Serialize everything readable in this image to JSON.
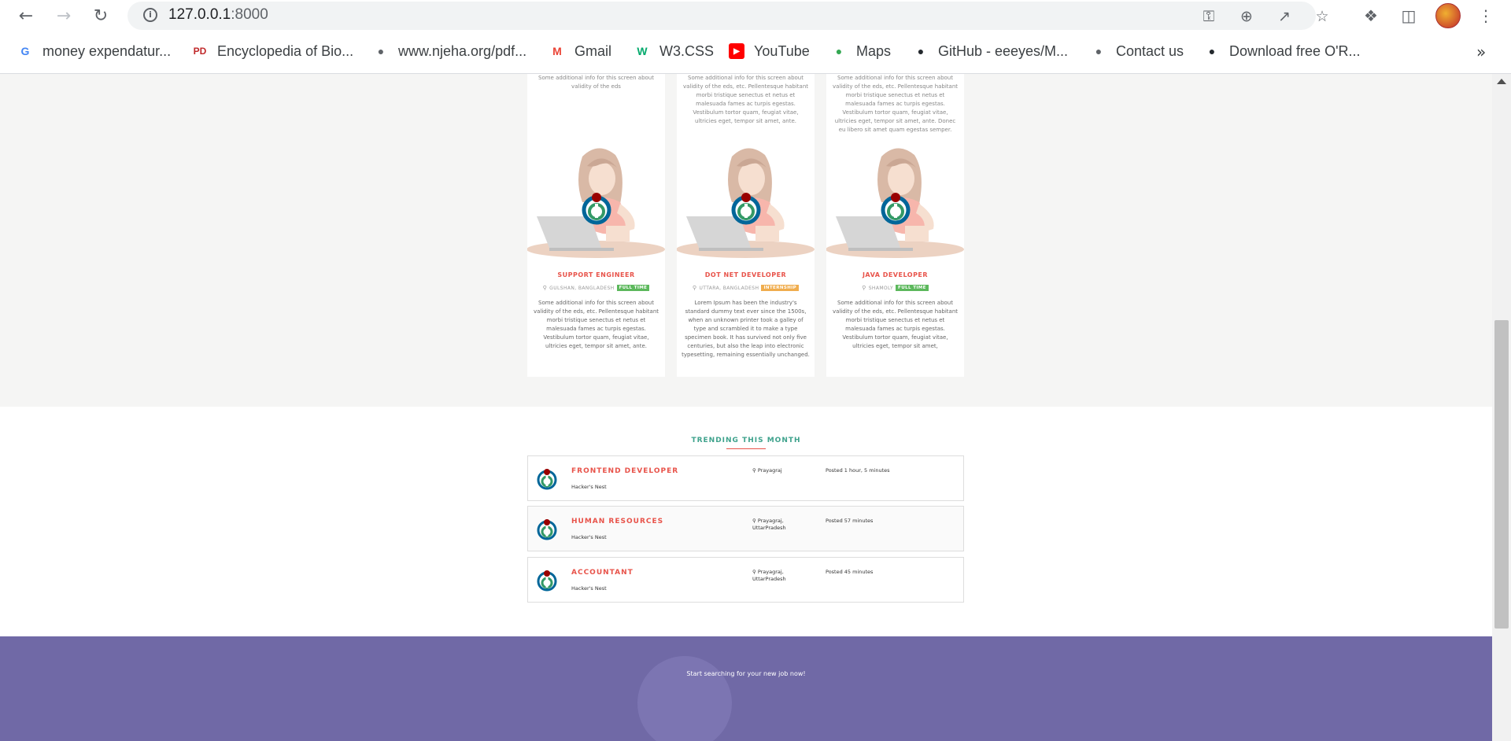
{
  "browser": {
    "url_host": "127.0.0.1",
    "url_port": ":8000",
    "bookmarks": [
      {
        "label": "money expendatur...",
        "icon": "google-icon",
        "color": "#4285f4"
      },
      {
        "label": "Encyclopedia of Bio...",
        "icon": "pd-icon",
        "color": "#c0282a"
      },
      {
        "label": "www.njeha.org/pdf...",
        "icon": "globe-icon",
        "color": "#5f6368"
      },
      {
        "label": "Gmail",
        "icon": "gmail-icon",
        "color": "#ea4335"
      },
      {
        "label": "W3.CSS",
        "icon": "w3-icon",
        "color": "#04aa6d"
      },
      {
        "label": "YouTube",
        "icon": "youtube-icon",
        "color": "#ff0000"
      },
      {
        "label": "Maps",
        "icon": "maps-icon",
        "color": "#34a853"
      },
      {
        "label": "GitHub - eeeyes/M...",
        "icon": "github-icon",
        "color": "#24292e"
      },
      {
        "label": "Contact us",
        "icon": "globe-icon",
        "color": "#5f6368"
      },
      {
        "label": "Download free O'R...",
        "icon": "github-icon",
        "color": "#24292e"
      }
    ],
    "more_label": "»"
  },
  "cards": [
    {
      "top_text": "Some additional info for this screen about validity of the eds",
      "title": "SUPPORT ENGINEER",
      "location": "GULSHAN, BANGLADESH",
      "badge": "FULL TIME",
      "badge_color": "#5cb85c",
      "description": "Some additional info for this screen about validity of the eds, etc. Pellentesque habitant morbi tristique senectus et netus et malesuada fames ac turpis egestas. Vestibulum tortor quam, feugiat vitae, ultricies eget, tempor sit amet, ante."
    },
    {
      "top_text": "Some additional info for this screen about validity of the eds, etc. Pellentesque habitant morbi tristique senectus et netus et malesuada fames ac turpis egestas. Vestibulum tortor quam, feugiat vitae, ultricies eget, tempor sit amet, ante.",
      "title": "DOT NET DEVELOPER",
      "location": "UTTARA, BANGLADESH",
      "badge": "INTERNSHIP",
      "badge_color": "#f0ad4e",
      "description": "Lorem Ipsum has been the industry's standard dummy text ever since the 1500s, when an unknown printer took a galley of type and scrambled it to make a type specimen book. It has survived not only five centuries, but also the leap into electronic typesetting, remaining essentially unchanged."
    },
    {
      "top_text": "Some additional info for this screen about validity of the eds, etc. Pellentesque habitant morbi tristique senectus et netus et malesuada fames ac turpis egestas. Vestibulum tortor quam, feugiat vitae, ultricies eget, tempor sit amet, ante. Donec eu libero sit amet quam egestas semper.",
      "title": "JAVA DEVELOPER",
      "location": "SHAMOLY",
      "badge": "FULL TIME",
      "badge_color": "#5cb85c",
      "description": "Some additional info for this screen about validity of the eds, etc. Pellentesque habitant morbi tristique senectus et netus et malesuada fames ac turpis egestas. Vestibulum tortor quam, feugiat vitae, ultricies eget, tempor sit amet,"
    }
  ],
  "trending": {
    "title": "TRENDING THIS MONTH",
    "jobs": [
      {
        "title": "FRONTEND DEVELOPER",
        "company": "Hacker's Nest",
        "location": "Prayagraj",
        "posted": "Posted 1 hour, 5 minutes"
      },
      {
        "title": "HUMAN RESOURCES",
        "company": "Hacker's Nest",
        "location": "Prayagraj, UttarPradesh",
        "posted": "Posted 57 minutes"
      },
      {
        "title": "ACCOUNTANT",
        "company": "Hacker's Nest",
        "location": "Prayagraj, UttarPradesh",
        "posted": "Posted 45 minutes"
      }
    ]
  },
  "footer": {
    "tagline": "Start searching for your new job now!"
  },
  "colors": {
    "accent_red": "#e8534a",
    "accent_teal": "#3ea28c",
    "footer_purple": "#7069a6"
  }
}
